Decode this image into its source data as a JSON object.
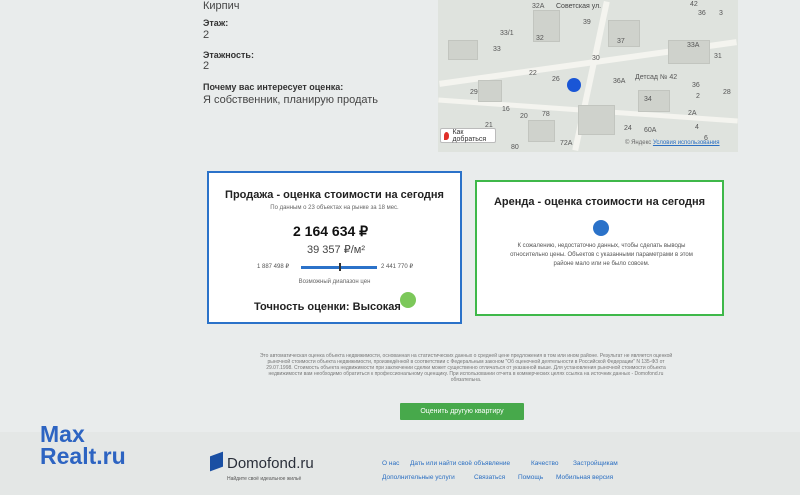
{
  "top": {
    "material_value": "Кирпич",
    "floor_label": "Этаж:",
    "floor_value": "2",
    "floors_label": "Этажность:",
    "floors_value": "2",
    "interest_label": "Почему вас интересует оценка:",
    "interest_value": "Я собственник, планирую продать"
  },
  "map": {
    "street": "Советская ул.",
    "kindergarten": "Детсад № 42",
    "route_button": "Как добраться",
    "copyright": "© Яндекс",
    "terms": "Условия использования",
    "labels": [
      "32А",
      "42",
      "36",
      "39",
      "3",
      "33/1",
      "32",
      "37",
      "33А",
      "33",
      "30",
      "31",
      "26",
      "22",
      "36А",
      "29",
      "36",
      "34",
      "2",
      "28",
      "16",
      "20",
      "78",
      "24",
      "2А",
      "21",
      "60А",
      "4",
      "6",
      "80",
      "72А"
    ]
  },
  "sale": {
    "title": "Продажа - оценка стоимости на сегодня",
    "subtitle": "По данным о 23 объектах на рынке за 18 мес.",
    "price": "2 164 634 ₽",
    "per_sqm": "39 357 ₽/м²",
    "range_min": "1 887 498 ₽",
    "range_max": "2 441 770 ₽",
    "range_caption": "Возможный диапазон цен",
    "accuracy": "Точность оценки: Высокая"
  },
  "rent": {
    "title": "Аренда - оценка стоимости на сегодня",
    "message_line1": "К сожалению, недостаточно данных, чтобы сделать выводы",
    "message_line2": "относительно цены. Объектов с указанными параметрами в этом",
    "message_line3": "районе мало или не было совсем."
  },
  "disclaimer": {
    "line1": "Это автоматическая оценка объекта недвижимости, основанная на статистических данных о средней цене предложения в том или ином районе. Результат не является оценкой",
    "line2": "рыночной стоимости объекта недвижимости, произведённой в соответствии с Федеральным законом \"Об оценочной деятельности в Российской Федерации\" N 135-ФЗ от",
    "line3": "29.07.1998. Стоимость объекта недвижимости при заключении сделки может существенно отличаться от указанной выше. Для установления рыночной стоимости объекта",
    "line4": "недвижимости вам необходимо обратиться к профессиональному оценщику. При использовании отчета в коммерческих целях ссылка на источник данных - Domofond.ru",
    "line5": "обязательна."
  },
  "cta": {
    "label": "Оценить другую квартиру"
  },
  "footer": {
    "logo": "Domofond.ru",
    "slogan": "Найдите своё идеальное жильё",
    "links_row1": [
      "О нас",
      "Дать или найти своё объявление",
      "Качество",
      "Застройщикам"
    ],
    "links_row2": [
      "Дополнительные услуги",
      "Связаться",
      "Помощь",
      "Мобильная версия"
    ]
  },
  "watermark": {
    "line1": "Max",
    "line2": "Realt.ru"
  },
  "colors": {
    "blue": "#2b72c9",
    "green": "#3fb84a",
    "button": "#47a94b"
  }
}
